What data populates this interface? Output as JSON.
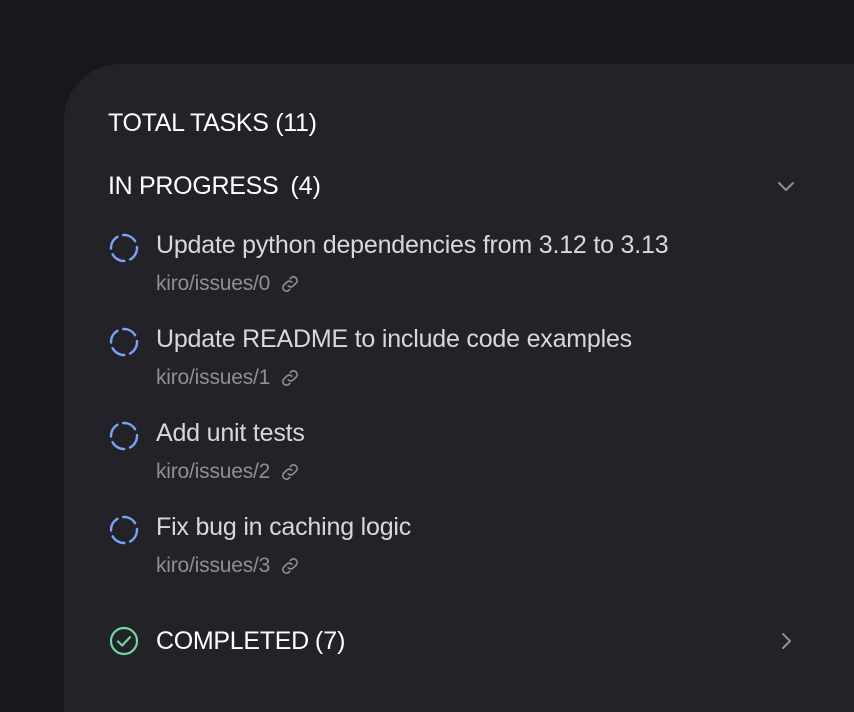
{
  "summary": {
    "total_label": "TOTAL TASKS (11)"
  },
  "in_progress": {
    "label": "IN PROGRESS",
    "count": "(4)",
    "toggle_icon": "chevron-down-icon",
    "tasks": [
      {
        "title": "Update python dependencies from 3.12 to 3.13",
        "ref": "kiro/issues/0",
        "status_icon": "in-progress-spinner-icon",
        "link_icon": "link-icon"
      },
      {
        "title": "Update README to include code examples",
        "ref": "kiro/issues/1",
        "status_icon": "in-progress-spinner-icon",
        "link_icon": "link-icon"
      },
      {
        "title": "Add unit tests",
        "ref": "kiro/issues/2",
        "status_icon": "in-progress-spinner-icon",
        "link_icon": "link-icon"
      },
      {
        "title": "Fix bug in caching logic",
        "ref": "kiro/issues/3",
        "status_icon": "in-progress-spinner-icon",
        "link_icon": "link-icon"
      }
    ]
  },
  "completed": {
    "label": "COMPLETED",
    "count": "(7)",
    "status_icon": "check-circle-icon",
    "toggle_icon": "chevron-right-icon"
  },
  "colors": {
    "background": "#18171c",
    "panel": "#232228",
    "spinner": "#7aa2f7",
    "check": "#6fd6a0",
    "muted_text": "#8f8e96"
  }
}
